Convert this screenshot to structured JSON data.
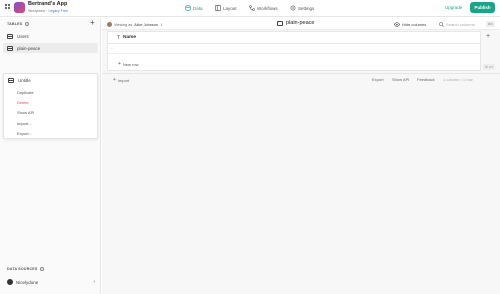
{
  "app": {
    "name": "Bertrand's App",
    "workspace": "Nicelydone",
    "separator": "·",
    "plan": "Legacy Free"
  },
  "nav": {
    "tabs": [
      {
        "label": "Data",
        "icon": "database-icon",
        "active": true
      },
      {
        "label": "Layout",
        "icon": "layout-icon",
        "active": false
      },
      {
        "label": "Workflows",
        "icon": "workflow-icon",
        "active": false
      },
      {
        "label": "Settings",
        "icon": "gear-icon",
        "active": false
      }
    ],
    "upgrade_label": "Upgrade",
    "publish_label": "Publish"
  },
  "sidebar": {
    "tables_heading": "TABLES",
    "add_symbol": "+",
    "tables": [
      {
        "label": "Users",
        "selected": false
      },
      {
        "label": "plain-peace",
        "selected": true
      },
      {
        "label": "Untitle",
        "selected": false
      }
    ],
    "context_menu": [
      "Duplicate",
      "Delete",
      "Show API",
      "Import...",
      "Export..."
    ],
    "data_sources_heading": "DATA SOURCES",
    "data_source": "Nicelydone"
  },
  "main": {
    "viewing_prefix": "Viewing as",
    "viewing_user": "Alice Johnson",
    "table_title": "plain-peace",
    "hide_columns_label": "Hide columns",
    "search_placeholder": "Search columns",
    "search_shortcut": "⌘K",
    "column_type_symbol": "T",
    "column_name": "Name",
    "new_row_label": "New row",
    "add_column_symbol": "+",
    "row_count_badge": "⌘ 0/1",
    "footer": {
      "import_label": "Import",
      "export_label": "Export",
      "show_api_label": "Show API",
      "feedback_label": "Feedback",
      "stats": "1 column • 1 row"
    }
  },
  "colors": {
    "accent": "#1aa58a",
    "danger": "#e24a4a",
    "link": "#2a7de1"
  }
}
